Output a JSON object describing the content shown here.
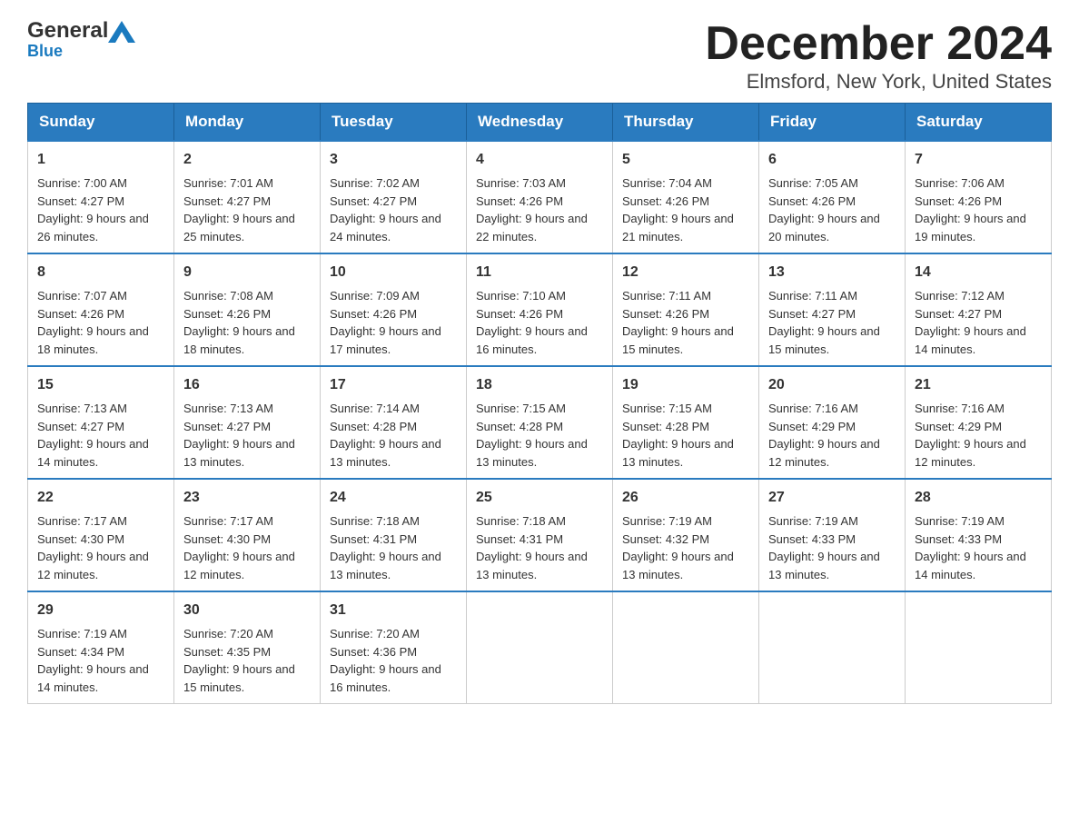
{
  "header": {
    "logo_text1": "General",
    "logo_text2": "Blue",
    "title": "December 2024",
    "subtitle": "Elmsford, New York, United States"
  },
  "days_of_week": [
    "Sunday",
    "Monday",
    "Tuesday",
    "Wednesday",
    "Thursday",
    "Friday",
    "Saturday"
  ],
  "weeks": [
    [
      {
        "day": "1",
        "sunrise": "Sunrise: 7:00 AM",
        "sunset": "Sunset: 4:27 PM",
        "daylight": "Daylight: 9 hours and 26 minutes."
      },
      {
        "day": "2",
        "sunrise": "Sunrise: 7:01 AM",
        "sunset": "Sunset: 4:27 PM",
        "daylight": "Daylight: 9 hours and 25 minutes."
      },
      {
        "day": "3",
        "sunrise": "Sunrise: 7:02 AM",
        "sunset": "Sunset: 4:27 PM",
        "daylight": "Daylight: 9 hours and 24 minutes."
      },
      {
        "day": "4",
        "sunrise": "Sunrise: 7:03 AM",
        "sunset": "Sunset: 4:26 PM",
        "daylight": "Daylight: 9 hours and 22 minutes."
      },
      {
        "day": "5",
        "sunrise": "Sunrise: 7:04 AM",
        "sunset": "Sunset: 4:26 PM",
        "daylight": "Daylight: 9 hours and 21 minutes."
      },
      {
        "day": "6",
        "sunrise": "Sunrise: 7:05 AM",
        "sunset": "Sunset: 4:26 PM",
        "daylight": "Daylight: 9 hours and 20 minutes."
      },
      {
        "day": "7",
        "sunrise": "Sunrise: 7:06 AM",
        "sunset": "Sunset: 4:26 PM",
        "daylight": "Daylight: 9 hours and 19 minutes."
      }
    ],
    [
      {
        "day": "8",
        "sunrise": "Sunrise: 7:07 AM",
        "sunset": "Sunset: 4:26 PM",
        "daylight": "Daylight: 9 hours and 18 minutes."
      },
      {
        "day": "9",
        "sunrise": "Sunrise: 7:08 AM",
        "sunset": "Sunset: 4:26 PM",
        "daylight": "Daylight: 9 hours and 18 minutes."
      },
      {
        "day": "10",
        "sunrise": "Sunrise: 7:09 AM",
        "sunset": "Sunset: 4:26 PM",
        "daylight": "Daylight: 9 hours and 17 minutes."
      },
      {
        "day": "11",
        "sunrise": "Sunrise: 7:10 AM",
        "sunset": "Sunset: 4:26 PM",
        "daylight": "Daylight: 9 hours and 16 minutes."
      },
      {
        "day": "12",
        "sunrise": "Sunrise: 7:11 AM",
        "sunset": "Sunset: 4:26 PM",
        "daylight": "Daylight: 9 hours and 15 minutes."
      },
      {
        "day": "13",
        "sunrise": "Sunrise: 7:11 AM",
        "sunset": "Sunset: 4:27 PM",
        "daylight": "Daylight: 9 hours and 15 minutes."
      },
      {
        "day": "14",
        "sunrise": "Sunrise: 7:12 AM",
        "sunset": "Sunset: 4:27 PM",
        "daylight": "Daylight: 9 hours and 14 minutes."
      }
    ],
    [
      {
        "day": "15",
        "sunrise": "Sunrise: 7:13 AM",
        "sunset": "Sunset: 4:27 PM",
        "daylight": "Daylight: 9 hours and 14 minutes."
      },
      {
        "day": "16",
        "sunrise": "Sunrise: 7:13 AM",
        "sunset": "Sunset: 4:27 PM",
        "daylight": "Daylight: 9 hours and 13 minutes."
      },
      {
        "day": "17",
        "sunrise": "Sunrise: 7:14 AM",
        "sunset": "Sunset: 4:28 PM",
        "daylight": "Daylight: 9 hours and 13 minutes."
      },
      {
        "day": "18",
        "sunrise": "Sunrise: 7:15 AM",
        "sunset": "Sunset: 4:28 PM",
        "daylight": "Daylight: 9 hours and 13 minutes."
      },
      {
        "day": "19",
        "sunrise": "Sunrise: 7:15 AM",
        "sunset": "Sunset: 4:28 PM",
        "daylight": "Daylight: 9 hours and 13 minutes."
      },
      {
        "day": "20",
        "sunrise": "Sunrise: 7:16 AM",
        "sunset": "Sunset: 4:29 PM",
        "daylight": "Daylight: 9 hours and 12 minutes."
      },
      {
        "day": "21",
        "sunrise": "Sunrise: 7:16 AM",
        "sunset": "Sunset: 4:29 PM",
        "daylight": "Daylight: 9 hours and 12 minutes."
      }
    ],
    [
      {
        "day": "22",
        "sunrise": "Sunrise: 7:17 AM",
        "sunset": "Sunset: 4:30 PM",
        "daylight": "Daylight: 9 hours and 12 minutes."
      },
      {
        "day": "23",
        "sunrise": "Sunrise: 7:17 AM",
        "sunset": "Sunset: 4:30 PM",
        "daylight": "Daylight: 9 hours and 12 minutes."
      },
      {
        "day": "24",
        "sunrise": "Sunrise: 7:18 AM",
        "sunset": "Sunset: 4:31 PM",
        "daylight": "Daylight: 9 hours and 13 minutes."
      },
      {
        "day": "25",
        "sunrise": "Sunrise: 7:18 AM",
        "sunset": "Sunset: 4:31 PM",
        "daylight": "Daylight: 9 hours and 13 minutes."
      },
      {
        "day": "26",
        "sunrise": "Sunrise: 7:19 AM",
        "sunset": "Sunset: 4:32 PM",
        "daylight": "Daylight: 9 hours and 13 minutes."
      },
      {
        "day": "27",
        "sunrise": "Sunrise: 7:19 AM",
        "sunset": "Sunset: 4:33 PM",
        "daylight": "Daylight: 9 hours and 13 minutes."
      },
      {
        "day": "28",
        "sunrise": "Sunrise: 7:19 AM",
        "sunset": "Sunset: 4:33 PM",
        "daylight": "Daylight: 9 hours and 14 minutes."
      }
    ],
    [
      {
        "day": "29",
        "sunrise": "Sunrise: 7:19 AM",
        "sunset": "Sunset: 4:34 PM",
        "daylight": "Daylight: 9 hours and 14 minutes."
      },
      {
        "day": "30",
        "sunrise": "Sunrise: 7:20 AM",
        "sunset": "Sunset: 4:35 PM",
        "daylight": "Daylight: 9 hours and 15 minutes."
      },
      {
        "day": "31",
        "sunrise": "Sunrise: 7:20 AM",
        "sunset": "Sunset: 4:36 PM",
        "daylight": "Daylight: 9 hours and 16 minutes."
      },
      null,
      null,
      null,
      null
    ]
  ]
}
